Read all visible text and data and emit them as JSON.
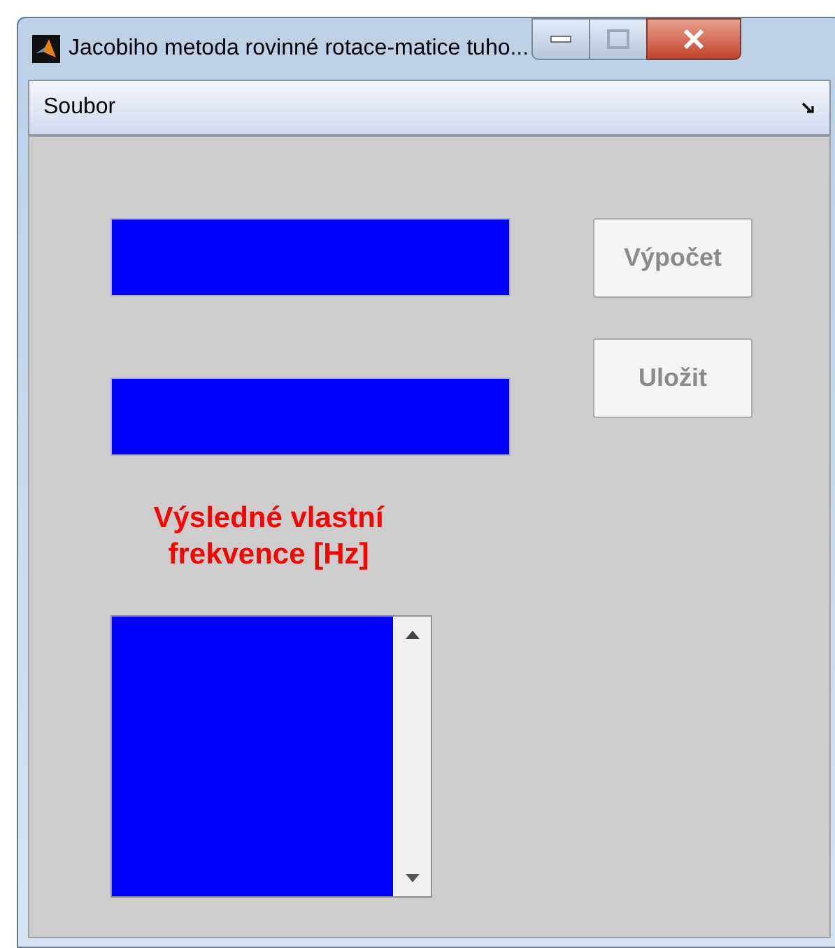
{
  "window": {
    "title": "Jacobiho metoda rovinné rotace-matice tuho..."
  },
  "menu": [
    {
      "label": "Soubor"
    }
  ],
  "fields": [
    {
      "kind": "edit"
    },
    {
      "kind": "edit"
    }
  ],
  "buttons": [
    {
      "label": "Výpočet",
      "disabled": true
    },
    {
      "label": "Uložit",
      "disabled": true
    }
  ],
  "result_label": "Výsledné vlastní frekvence [Hz]",
  "listbox": {
    "kind": "list"
  }
}
